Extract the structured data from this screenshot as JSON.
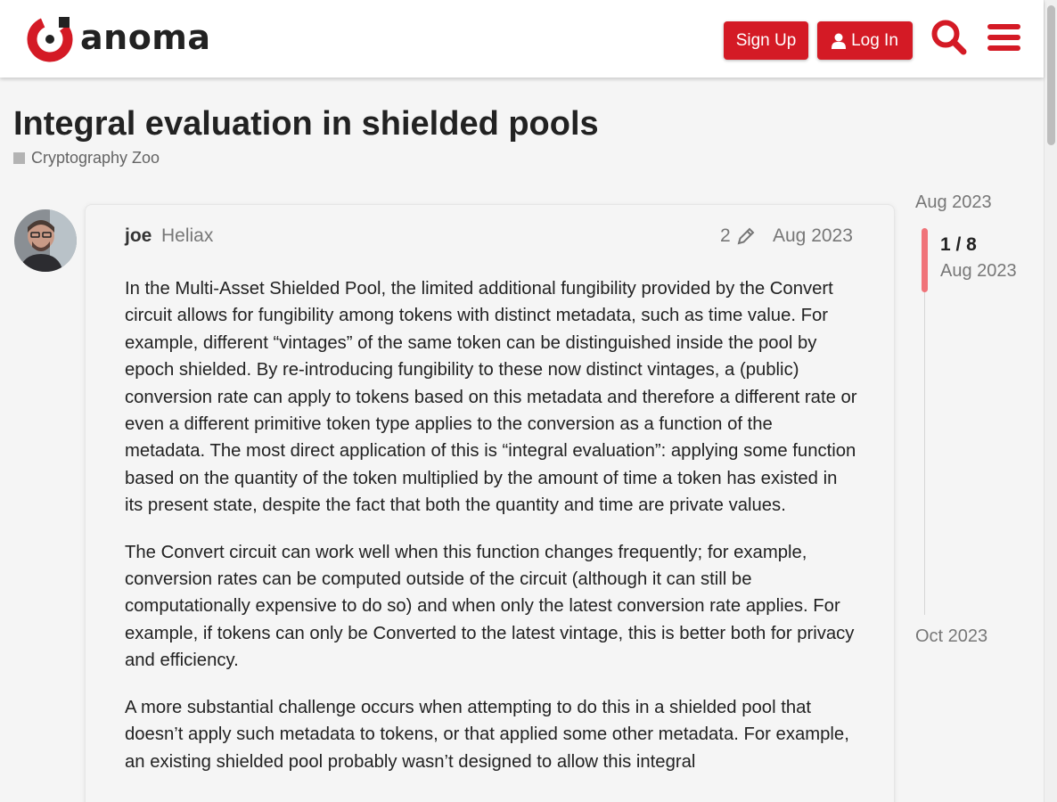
{
  "header": {
    "logo_text": "anoma",
    "signup_label": "Sign Up",
    "login_label": "Log In",
    "accent_color": "#d41a25"
  },
  "topic": {
    "title": "Integral evaluation in shielded pools",
    "category": "Cryptography Zoo"
  },
  "post": {
    "username": "joe",
    "user_title": "Heliax",
    "edit_count": "2",
    "date": "Aug 2023",
    "paragraphs": [
      "In the Multi-Asset Shielded Pool, the limited additional fungibility provided by the Convert circuit allows for fungibility among tokens with distinct metadata, such as time value. For example, different “vintages” of the same token can be distinguished inside the pool by epoch shielded. By re-introducing fungibility to these now distinct vintages, a (public) conversion rate can apply to tokens based on this metadata and therefore a different rate or even a different primitive token type applies to the conversion as a function of the metadata. The most direct application of this is “integral evaluation”: applying some function based on the quantity of the token multiplied by the amount of time a token has existed in its present state, despite the fact that both the quantity and time are private values.",
      "The Convert circuit can work well when this function changes frequently; for example, conversion rates can be computed outside of the circuit (although it can still be computationally expensive to do so) and when only the latest conversion rate applies. For example, if tokens can only be Converted to the latest vintage, this is better both for privacy and efficiency.",
      "A more substantial challenge occurs when attempting to do this in a shielded pool that doesn’t apply such metadata to tokens, or that applied some other metadata. For example, an existing shielded pool probably wasn’t designed to allow this integral"
    ]
  },
  "timeline": {
    "start_date": "Aug 2023",
    "progress": "1 / 8",
    "current_date": "Aug 2023",
    "end_date": "Oct 2023"
  }
}
